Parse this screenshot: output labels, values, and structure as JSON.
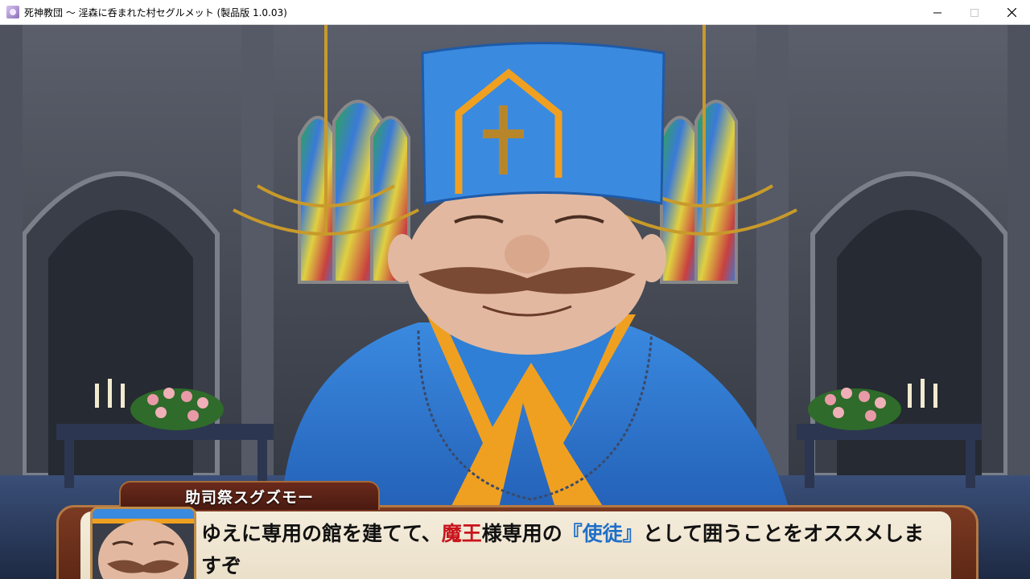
{
  "window": {
    "title": "死神教団 ～ 淫森に呑まれた村セグルメット (製品版 1.0.03)",
    "minimize_icon": "minimize-icon",
    "maximize_icon": "maximize-icon",
    "close_icon": "close-icon"
  },
  "dialog": {
    "speaker": "助司祭スグズモー",
    "line_part1": "ゆえに専用の館を建てて、",
    "line_red": "魔王",
    "line_part2": "様専用の",
    "line_blue": "『使徒』",
    "line_part3": "として囲うことをオススメしま",
    "line_part4": "すぞ"
  },
  "colors": {
    "highlight_red": "#c8141c",
    "highlight_blue": "#1f6fc8",
    "frame_brown": "#7b3a22",
    "robe_blue": "#2f7fd6"
  }
}
